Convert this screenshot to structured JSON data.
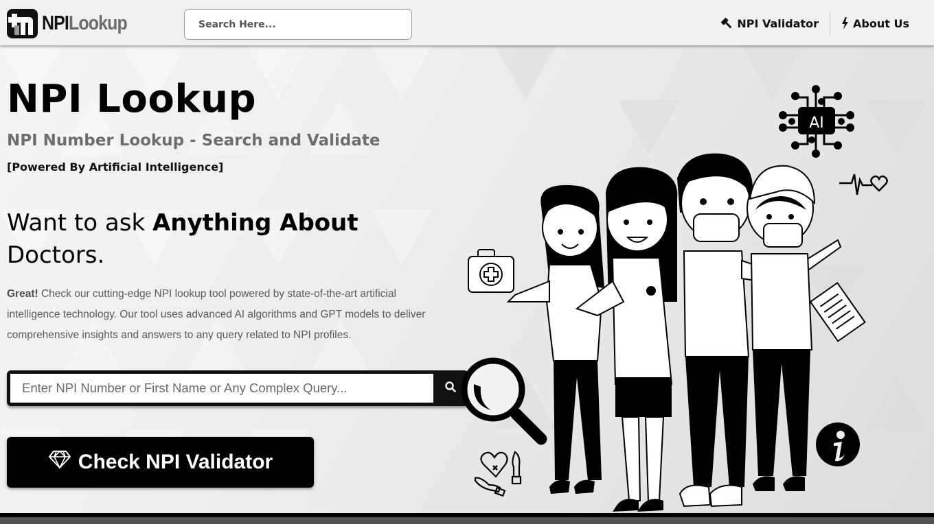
{
  "header": {
    "logo": {
      "part1": "NPI",
      "part2": "Lookup"
    },
    "search_placeholder": "Search Here...",
    "nav": [
      {
        "label": "NPI Validator",
        "icon": "gavel-icon"
      },
      {
        "label": "About Us",
        "icon": "bolt-icon"
      }
    ]
  },
  "hero": {
    "title": "NPI Lookup",
    "subtitle": "NPI Number Lookup - Search and Validate",
    "powered": "[Powered By Artificial Intelligence]",
    "ask_prefix": "Want to ask ",
    "ask_bold": "Anything About",
    "ask_suffix": "Doctors.",
    "desc_lead": "Great!",
    "desc_body": " Check our cutting-edge NPI lookup tool powered by state-of-the-art artificial intelligence technology. Our tool uses advanced AI algorithms and GPT models to deliver comprehensive insights and answers to any query related to NPI profiles.",
    "query_placeholder": "Enter NPI Number or First Name or Any Complex Query...",
    "validator_button": "Check NPI Validator",
    "ai_chip_label": "AI"
  },
  "colors": {
    "header_bg": "#f1f1f1",
    "primary": "#000000",
    "subtitle_gray": "#6e6e6e",
    "footer": "#505350"
  }
}
